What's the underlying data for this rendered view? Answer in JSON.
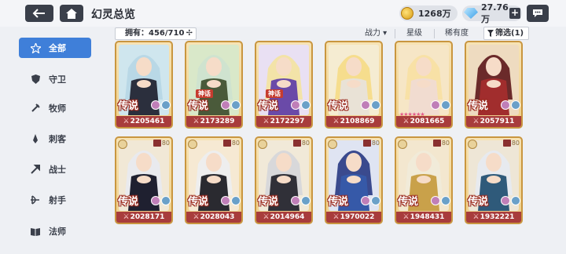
{
  "header": {
    "title": "幻灵总览",
    "gold": "1268万",
    "gems": "27.76万",
    "plus_label": "+",
    "colors": {
      "bar_bg": "#3a3f4a",
      "active_blue": "#3f7fd9"
    }
  },
  "sidebar": {
    "items": [
      {
        "label": "全部",
        "icon": "star-icon",
        "active": true
      },
      {
        "label": "守卫",
        "icon": "shield-icon",
        "active": false
      },
      {
        "label": "牧师",
        "icon": "staff-icon",
        "active": false
      },
      {
        "label": "刺客",
        "icon": "dagger-icon",
        "active": false
      },
      {
        "label": "战士",
        "icon": "axe-icon",
        "active": false
      },
      {
        "label": "射手",
        "icon": "bow-icon",
        "active": false
      },
      {
        "label": "法师",
        "icon": "book-icon",
        "active": false
      }
    ]
  },
  "filters": {
    "owned": "拥有：456/710",
    "owned_cross": "✢",
    "power": "战力 ▾",
    "star": "星级",
    "rarity": "稀有度",
    "filter": "筛选(1)"
  },
  "cards": [
    {
      "power": "2205461",
      "rank": "传说",
      "myth": "",
      "level": "",
      "hair": "#b9d8e6",
      "bg": "#cfe6ee",
      "dress": "#2b2f3d",
      "stars": ""
    },
    {
      "power": "2173289",
      "rank": "传说",
      "myth": "神话",
      "level": "",
      "hair": "#cfe3cf",
      "bg": "#d9e8c9",
      "dress": "#4a5a3a",
      "stars": ""
    },
    {
      "power": "2172297",
      "rank": "传说",
      "myth": "神话",
      "level": "",
      "hair": "#f3e3a8",
      "bg": "#e9e0f3",
      "dress": "#6a4aa8",
      "stars": ""
    },
    {
      "power": "2108869",
      "rank": "传说",
      "myth": "",
      "level": "",
      "hair": "#f6dd8d",
      "bg": "#f5ecd2",
      "dress": "#e9e2d6",
      "stars": ""
    },
    {
      "power": "2081665",
      "rank": "",
      "myth": "",
      "level": "",
      "hair": "#f8e1a6",
      "bg": "#f6e6c6",
      "dress": "#f1dcd0",
      "stars": "★★★★★★"
    },
    {
      "power": "2057911",
      "rank": "传说",
      "myth": "",
      "level": "",
      "hair": "#6b2a2a",
      "bg": "#eedbc0",
      "dress": "#a12d2d",
      "stars": ""
    },
    {
      "power": "2028171",
      "rank": "传说",
      "myth": "",
      "level": "80",
      "hair": "#e9eaee",
      "bg": "#f1e8d6",
      "dress": "#1f2030",
      "stars": ""
    },
    {
      "power": "2028043",
      "rank": "传说",
      "myth": "",
      "level": "80",
      "hair": "#eeeeee",
      "bg": "#f6e9d3",
      "dress": "#2a2a30",
      "stars": ""
    },
    {
      "power": "2014964",
      "rank": "传说",
      "myth": "",
      "level": "80",
      "hair": "#d8d8da",
      "bg": "#f1e9d8",
      "dress": "#303038",
      "stars": ""
    },
    {
      "power": "1970022",
      "rank": "传说",
      "myth": "",
      "level": "80",
      "hair": "#3a4a8e",
      "bg": "#dfe4f2",
      "dress": "#3659a8",
      "stars": ""
    },
    {
      "power": "1948431",
      "rank": "传说",
      "myth": "",
      "level": "80",
      "hair": "#f1ebd9",
      "bg": "#f3e7cf",
      "dress": "#c9a14a",
      "stars": ""
    },
    {
      "power": "1932221",
      "rank": "传说",
      "myth": "",
      "level": "80",
      "hair": "#e7eaef",
      "bg": "#eee6d6",
      "dress": "#2f5a7a",
      "stars": ""
    }
  ]
}
